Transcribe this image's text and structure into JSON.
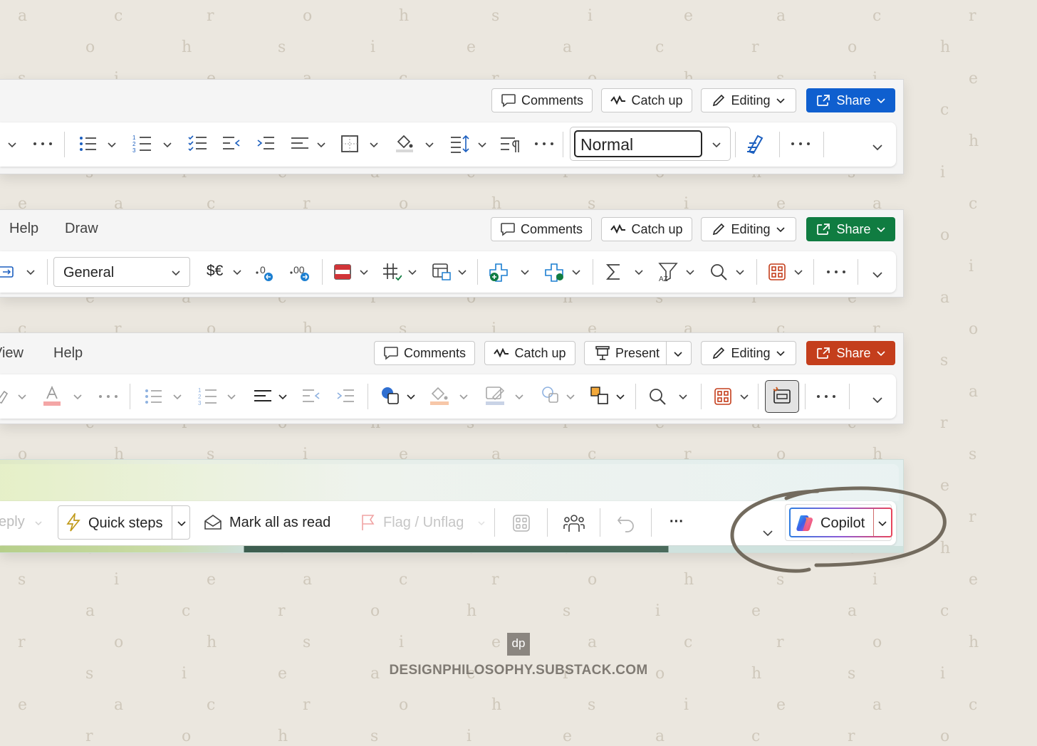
{
  "word": {
    "top_buttons": {
      "comments": "Comments",
      "catch_up": "Catch up",
      "editing": "Editing",
      "share": "Share"
    },
    "style_box": "Normal",
    "share_color": "#0f5fcf"
  },
  "excel": {
    "tabs": [
      "Help",
      "Draw"
    ],
    "top_buttons": {
      "comments": "Comments",
      "catch_up": "Catch up",
      "editing": "Editing",
      "share": "Share"
    },
    "number_format": "General",
    "currency_symbol": "$€",
    "share_color": "#107c41"
  },
  "powerpoint": {
    "tabs": [
      "View",
      "Help"
    ],
    "top_buttons": {
      "comments": "Comments",
      "catch_up": "Catch up",
      "present": "Present",
      "editing": "Editing",
      "share": "Share"
    },
    "share_color": "#c43e1c"
  },
  "outlook": {
    "reply_label": "eply",
    "quick_steps": "Quick steps",
    "mark_all_read": "Mark all as read",
    "flag_unflag": "Flag / Unflag",
    "more": "···",
    "copilot": "Copilot"
  },
  "footer": {
    "logo": "dp",
    "site": "DESIGNPHILOSOPHY.SUBSTACK.COM"
  },
  "pattern_letters": [
    "a",
    "c",
    "r",
    "o",
    "h",
    "s",
    "i",
    "e"
  ]
}
